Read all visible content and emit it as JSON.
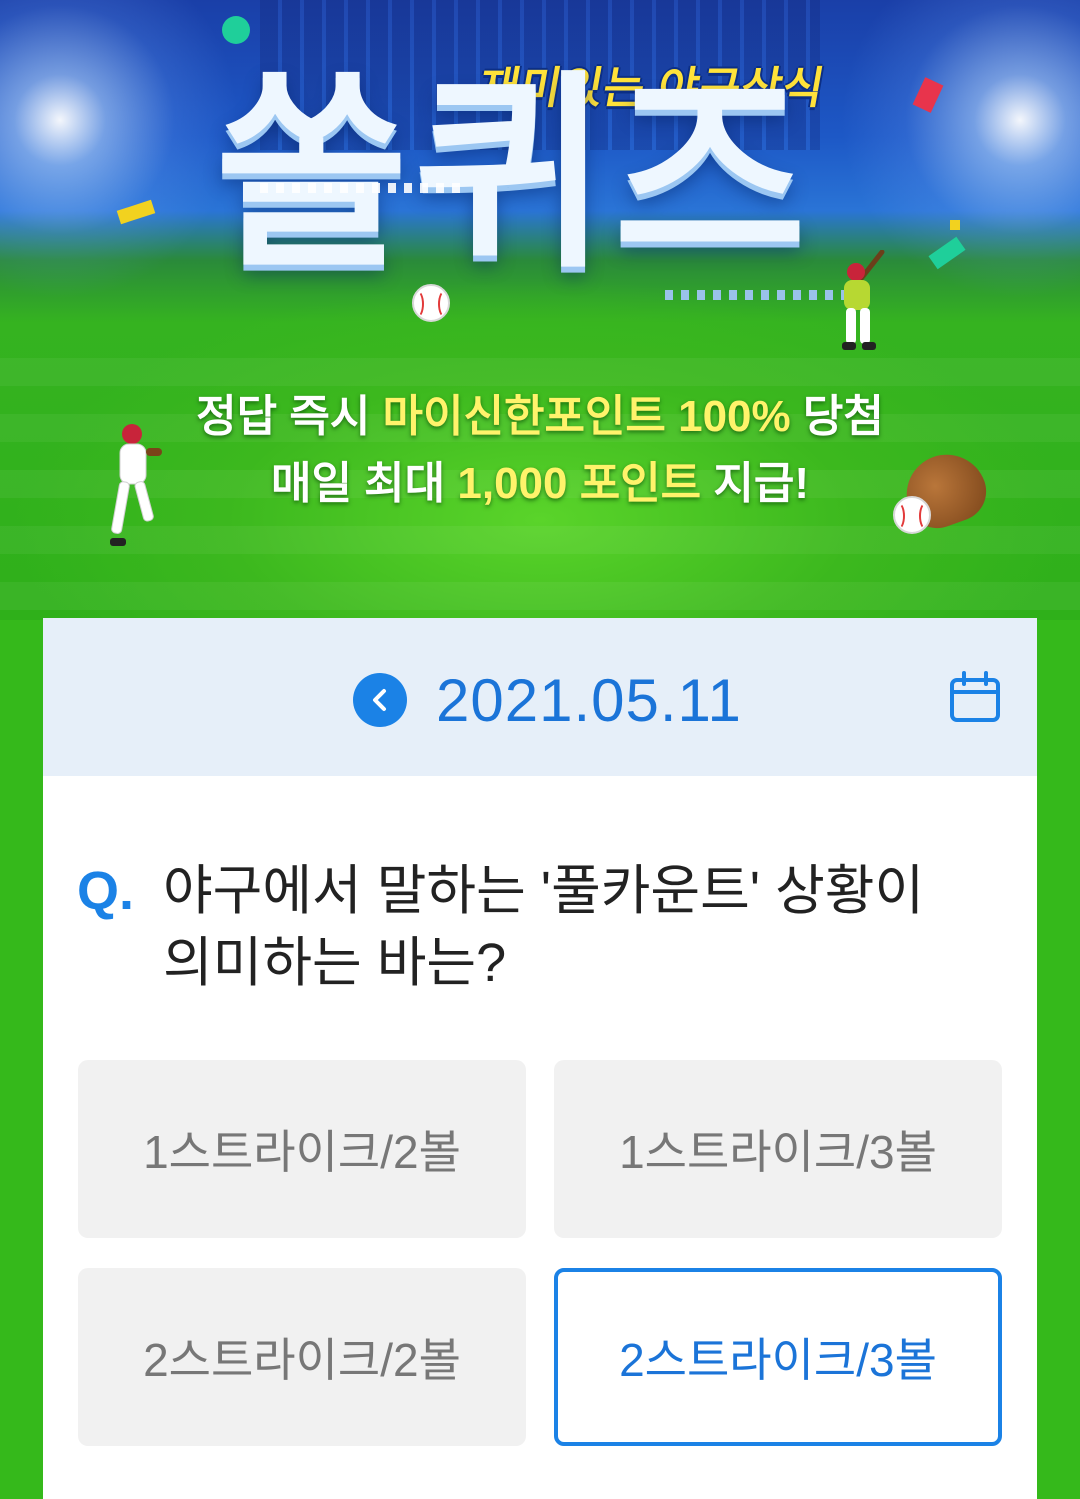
{
  "hero": {
    "subtitle": "재미있는 야구상식",
    "logo": "쏠퀴즈",
    "promo_line1_a": "정답 즉시 ",
    "promo_line1_highlight": "마이신한포인트 100%",
    "promo_line1_b": " 당첨",
    "promo_line2_a": "매일 최대 ",
    "promo_line2_highlight": "1,000 포인트",
    "promo_line2_b": " 지급!"
  },
  "date_nav": {
    "date": "2021.05.11",
    "prev_icon": "chevron-left-icon",
    "calendar_icon": "calendar-icon"
  },
  "quiz": {
    "q_prefix": "Q.",
    "question_line1": "야구에서 말하는 '풀카운트' 상황이",
    "question_line2": "의미하는 바는?",
    "options": [
      {
        "label": "1스트라이크/2볼",
        "selected": false
      },
      {
        "label": "1스트라이크/3볼",
        "selected": false
      },
      {
        "label": "2스트라이크/2볼",
        "selected": false
      },
      {
        "label": "2스트라이크/3볼",
        "selected": true
      }
    ]
  },
  "colors": {
    "accent": "#1b82e6",
    "highlight_text": "#fff36b",
    "subtitle_yellow": "#ffe23a",
    "background_green": "#35b91b",
    "datebar_bg": "#e6eff9",
    "option_bg": "#f1f1f1"
  }
}
